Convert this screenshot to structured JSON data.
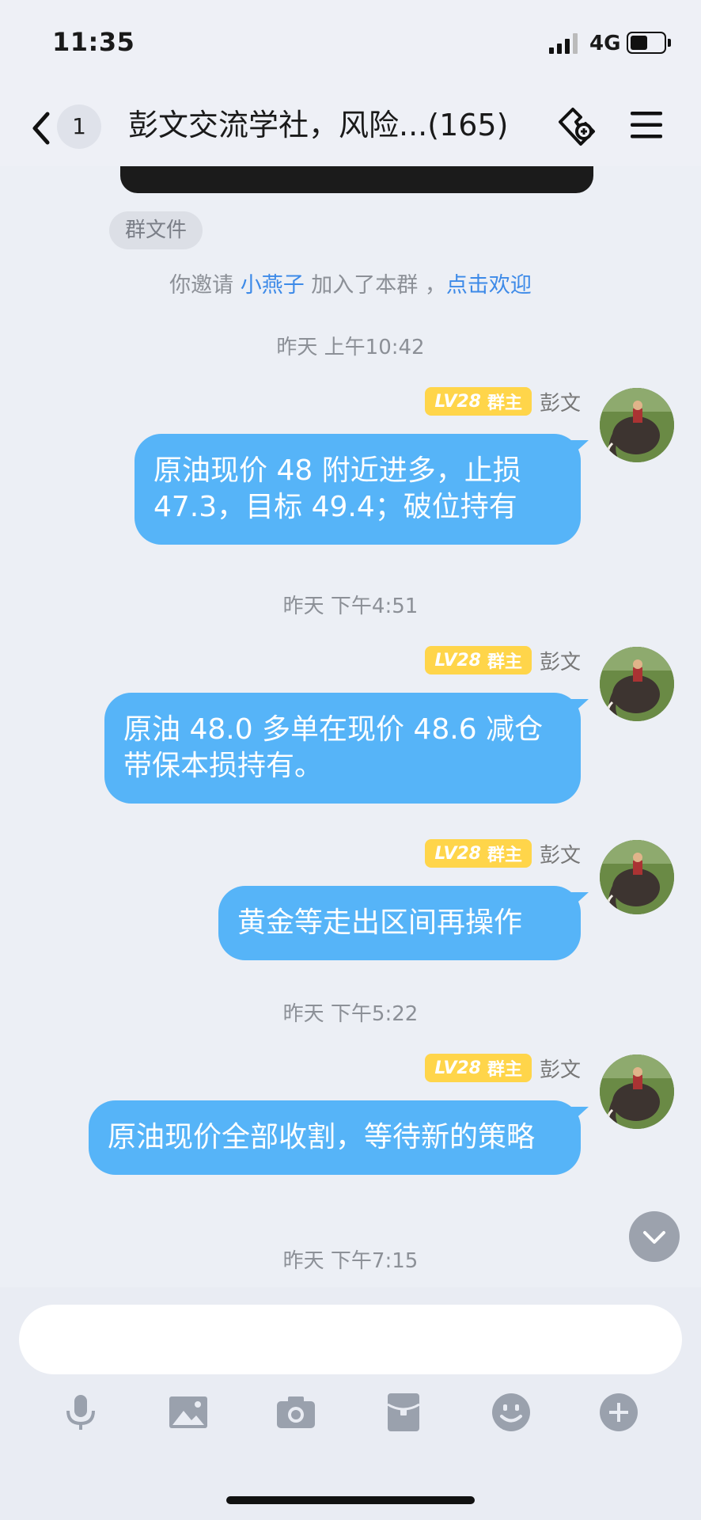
{
  "status_bar": {
    "time": "11:35",
    "network": "4G"
  },
  "header": {
    "unread_count": "1",
    "title": "彭文交流学社，风险...(165)"
  },
  "chat": {
    "file_tag": "群文件",
    "system_message": {
      "prefix": "你邀请 ",
      "user": "小燕子",
      "middle": "  加入了本群 ，",
      "action": "点击欢迎"
    },
    "messages": [
      {
        "timestamp": "昨天 上午10:42",
        "sender": "彭文",
        "level": "LV28",
        "role": "群主",
        "text": "原油现价 48 附近进多，止损 47.3，目标 49.4；破位持有"
      },
      {
        "timestamp": "昨天 下午4:51",
        "sender": "彭文",
        "level": "LV28",
        "role": "群主",
        "text": "原油 48.0 多单在现价 48.6 减仓带保本损持有。"
      },
      {
        "timestamp": "",
        "sender": "彭文",
        "level": "LV28",
        "role": "群主",
        "text": "黄金等走出区间再操作"
      },
      {
        "timestamp": "昨天 下午5:22",
        "sender": "彭文",
        "level": "LV28",
        "role": "群主",
        "text": "原油现价全部收割，等待新的策略"
      }
    ],
    "trailing_timestamp": "昨天 下午7:15"
  },
  "composer": {
    "placeholder": "",
    "tools": [
      "microphone-icon",
      "image-icon",
      "camera-icon",
      "red-packet-icon",
      "emoji-icon",
      "plus-icon"
    ]
  },
  "colors": {
    "bubble": "#56b4f8",
    "link": "#3d8ae8",
    "level_badge": "#ffd54a"
  }
}
